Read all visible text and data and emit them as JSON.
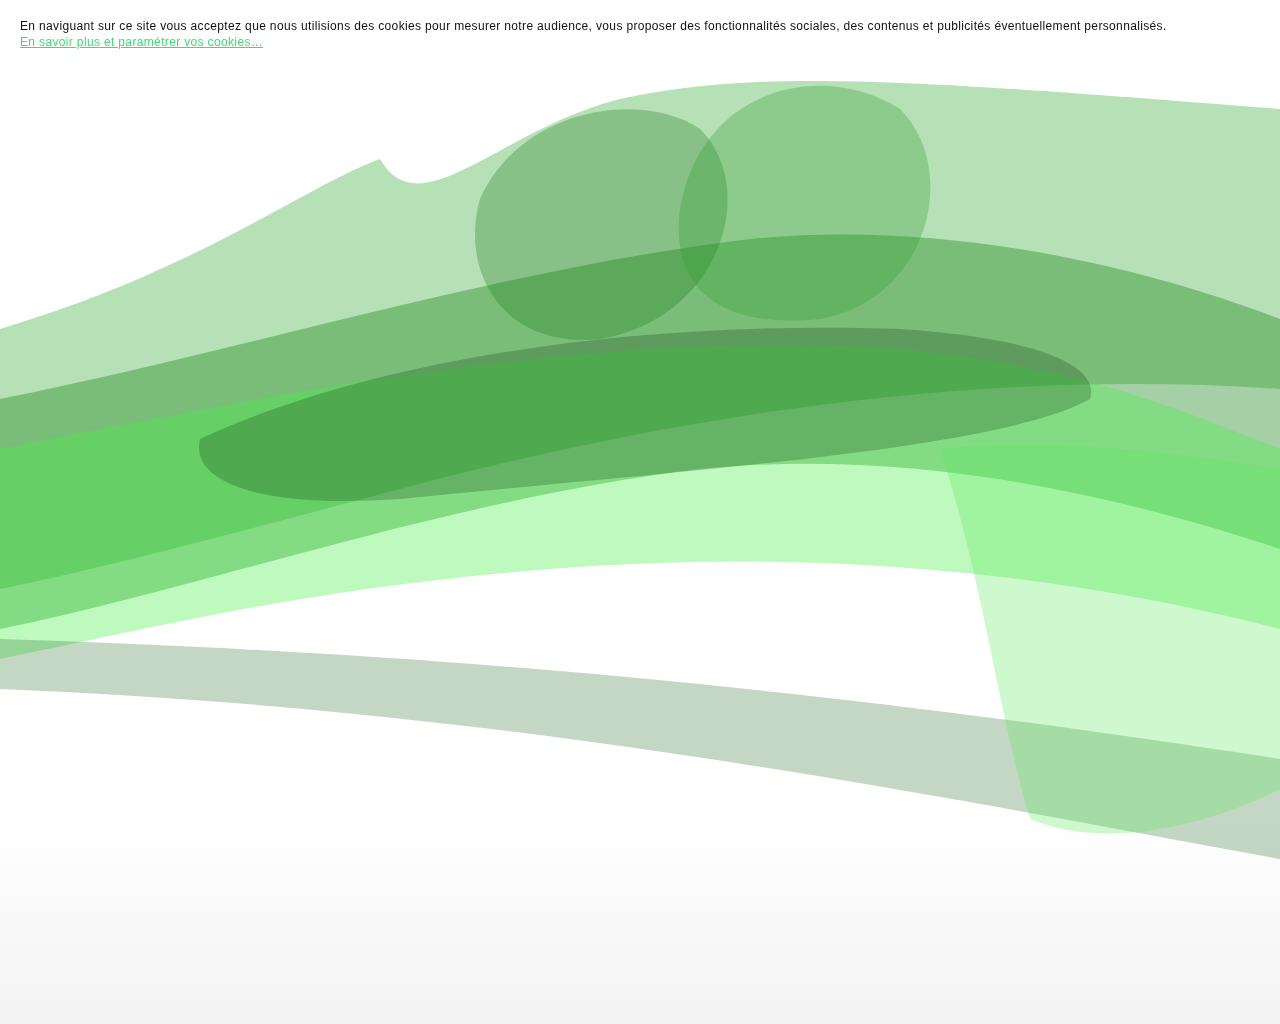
{
  "cookie_banner": {
    "message": "En naviguant sur ce site vous acceptez que nous utilisions des cookies pour mesurer notre audience, vous proposer des fonctionnalités sociales, des contenus et publicités éventuellement personnalisés.",
    "link": "En savoir plus et paramétrer vos cookies…"
  }
}
